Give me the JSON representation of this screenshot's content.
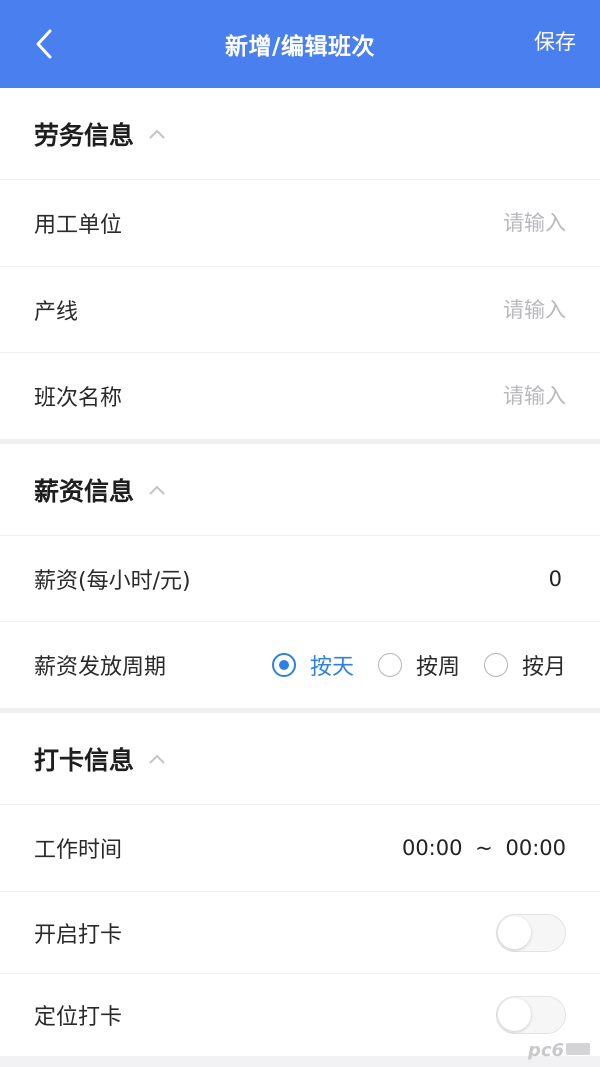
{
  "header": {
    "title": "新增/编辑班次",
    "save_label": "保存",
    "background_color": "#4a7ff0"
  },
  "labor_section": {
    "title": "劳务信息",
    "fields": [
      {
        "label": "用工单位",
        "placeholder": "请输入",
        "value": ""
      },
      {
        "label": "产线",
        "placeholder": "请输入",
        "value": ""
      },
      {
        "label": "班次名称",
        "placeholder": "请输入",
        "value": ""
      }
    ]
  },
  "salary_section": {
    "title": "薪资信息",
    "hourly_label": "薪资(每小时/元)",
    "hourly_value": "0",
    "period_label": "薪资发放周期",
    "period_options": [
      "按天",
      "按周",
      "按月"
    ],
    "period_selected": "按天",
    "accent_color": "#2f7fe5"
  },
  "clock_section": {
    "title": "打卡信息",
    "work_time_label": "工作时间",
    "work_time_start": "00:00",
    "work_time_separator": "~",
    "work_time_end": "00:00",
    "enable_clock_label": "开启打卡",
    "enable_clock_on": false,
    "location_clock_label": "定位打卡",
    "location_clock_on": false
  },
  "icons": {
    "back": "chevron-left-icon",
    "collapse": "chevron-up-icon",
    "watermark": "pc6-logo"
  }
}
